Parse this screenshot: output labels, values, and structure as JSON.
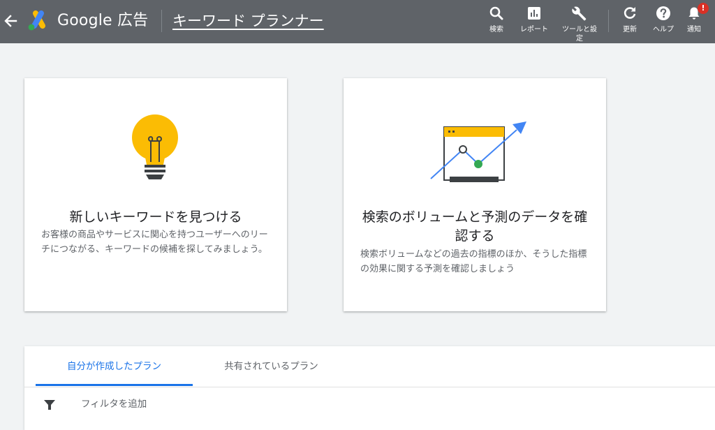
{
  "header": {
    "brand": "Google 広告",
    "page_title": "キーワード プランナー",
    "tools": [
      {
        "icon": "search-icon",
        "label": "検索"
      },
      {
        "icon": "report-icon",
        "label": "レポート"
      },
      {
        "icon": "wrench-icon",
        "label": "ツールと設定"
      },
      {
        "icon": "refresh-icon",
        "label": "更新"
      },
      {
        "icon": "help-icon",
        "label": "ヘルプ"
      },
      {
        "icon": "bell-icon",
        "label": "通知",
        "badge": "!"
      }
    ]
  },
  "cards": [
    {
      "icon": "lightbulb-icon",
      "title": "新しいキーワードを見つける",
      "description": "お客様の商品やサービスに関心を持つユーザーへのリーチにつながる、キーワードの候補を探してみましょう。"
    },
    {
      "icon": "forecast-chart-icon",
      "title": "検索のボリュームと予測のデータを確認する",
      "description": "検索ボリュームなどの過去の指標のほか、そうした指標の効果に関する予測を確認しましょう"
    }
  ],
  "plans": {
    "tabs": [
      {
        "label": "自分が作成したプラン",
        "active": true
      },
      {
        "label": "共有されているプラン",
        "active": false
      }
    ],
    "filter_label": "フィルタを追加"
  },
  "colors": {
    "header_bg": "#5f6368",
    "accent": "#1a73e8",
    "bulb_yellow": "#fbbc04",
    "badge_red": "#d93025",
    "chart_green": "#34a853",
    "chart_arrow_blue": "#4285f4"
  }
}
